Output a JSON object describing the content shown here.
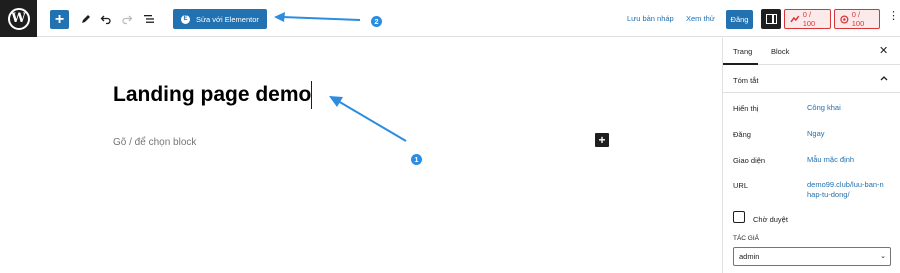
{
  "toolbar": {
    "wp_logo_letter": "W",
    "add_block_symbol": "+",
    "edit_elementor_label": "Sửa với Elementor",
    "elementor_icon_letter": "E",
    "save_draft_label": "Lưu bản nháp",
    "preview_label": "Xem thử",
    "publish_label": "Đăng",
    "seo_score": "0 / 100",
    "readability_score": "0 / 100",
    "more_symbol": "⋮"
  },
  "annotations": {
    "badge_1": "1",
    "badge_2": "2",
    "arrow_color": "#2c8de0"
  },
  "editor": {
    "post_title": "Landing page demo",
    "block_placeholder": "Gõ / để chọn block",
    "inline_add_symbol": "+"
  },
  "sidebar": {
    "tabs": [
      {
        "label": "Trang",
        "active": true
      },
      {
        "label": "Block",
        "active": false
      }
    ],
    "close_symbol": "✕",
    "panel_title": "Tóm tắt",
    "rows": [
      {
        "label": "Hiển thị",
        "value": "Công khai"
      },
      {
        "label": "Đăng",
        "value": "Ngay"
      },
      {
        "label": "Giao diện",
        "value": "Mẫu mặc định"
      },
      {
        "label": "URL",
        "value": "demo99.club/luu-ban-nhap-tu-dong/"
      }
    ],
    "pending_review_label": "Chờ duyệt",
    "author_label": "TÁC GIẢ",
    "author_value": "admin",
    "author_chevron": "⌄"
  },
  "colors": {
    "accent": "#2271b1",
    "dark": "#1e1e1e",
    "score_red": "#d63638",
    "score_bg": "#fce9ea"
  }
}
